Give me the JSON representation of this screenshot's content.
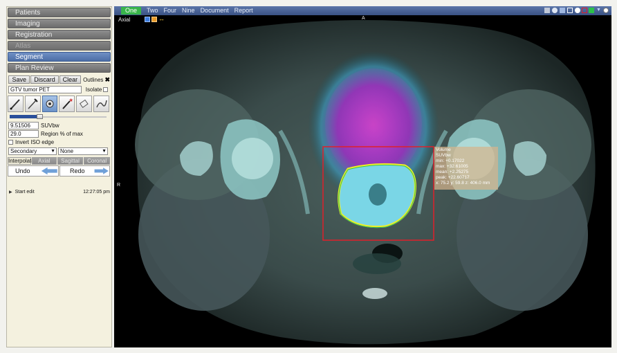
{
  "nav": {
    "items": [
      {
        "label": "Patients"
      },
      {
        "label": "Imaging"
      },
      {
        "label": "Registration"
      },
      {
        "label": "Atlas"
      },
      {
        "label": "Segment"
      },
      {
        "label": "Plan Review"
      }
    ]
  },
  "segment": {
    "save_label": "Save",
    "discard_label": "Discard",
    "clear_label": "Clear",
    "outlines_label": "Outlines",
    "structure_name": "GTV tumor PET",
    "isolate_label": "Isolate",
    "threshold_value": "9.51506",
    "threshold_unit": "SUVbw",
    "region_value": "29.0",
    "region_label": "Region % of max",
    "invert_label": "Invert ISO edge",
    "secondary_value": "Secondary",
    "none_value": "None",
    "threshold_slider_fraction": 0.28
  },
  "interpolate": {
    "label": "Interpolate",
    "axial": "Axial",
    "sagittal": "Sagittal",
    "coronal": "Coronal"
  },
  "history": {
    "undo_label": "Undo",
    "redo_label": "Redo",
    "entries": [
      {
        "name": "Start edit",
        "time": "12:27:05 pm"
      }
    ]
  },
  "viewer": {
    "tabs": [
      "One",
      "Two",
      "Four",
      "Nine",
      "Document",
      "Report"
    ],
    "active_tab": "One",
    "plane": "Axial",
    "orient_top": "A",
    "orient_left": "R",
    "stats": {
      "title": "Volume",
      "unit": "SUVbw",
      "min": "min: +0.17022",
      "max": "max: +32.61005",
      "mean": "mean: +2.25275",
      "peak": "peak: +22.60717",
      "coords": "x: 75.2  y: 59.8 z: 406.0 mm"
    }
  },
  "colors": {
    "accent": "#4d6ea6",
    "active_tab": "#39b54a",
    "roi_box": "#e0202a",
    "contour": "#f2ee24"
  }
}
